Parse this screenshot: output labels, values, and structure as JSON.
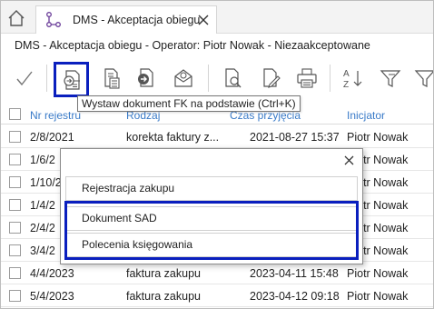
{
  "tab": {
    "title": "DMS - Akceptacja obiegu"
  },
  "subtitle": "DMS - Akceptacja obiegu - Operator: Piotr Nowak - Niezaakceptowane",
  "toolbar": {
    "icons": [
      "checkmark-icon",
      "document-arrow-icon",
      "document-calculator-icon",
      "document-arrow-circle-icon",
      "document-envelope-icon",
      "document-search-icon",
      "document-edit-icon",
      "printer-icon",
      "sort-az-icon",
      "filter-icon",
      "filter-icon"
    ],
    "tooltip": "Wystaw dokument FK na podstawie (Ctrl+K)"
  },
  "grid": {
    "columns": [
      "Nr rejestru",
      "Rodzaj",
      "Czas przyjęcia",
      "Inicjator"
    ],
    "rows": [
      {
        "nr": "2/8/2021",
        "rodzaj": "korekta faktury z...",
        "czas": "2021-08-27 15:37",
        "inicjator": "Piotr Nowak"
      },
      {
        "nr": "1/6/2",
        "rodzaj": "",
        "czas": "",
        "inicjator": "Piotr Nowak"
      },
      {
        "nr": "1/10/2",
        "rodzaj": "",
        "czas": "",
        "inicjator": "Piotr Nowak"
      },
      {
        "nr": "1/4/2",
        "rodzaj": "",
        "czas": "",
        "inicjator": "Piotr Nowak"
      },
      {
        "nr": "2/4/2",
        "rodzaj": "",
        "czas": "",
        "inicjator": "Piotr Nowak"
      },
      {
        "nr": "3/4/2",
        "rodzaj": "",
        "czas": "",
        "inicjator": "Piotr Nowak"
      },
      {
        "nr": "4/4/2023",
        "rodzaj": "faktura zakupu",
        "czas": "2023-04-11 15:48",
        "inicjator": "Piotr Nowak"
      },
      {
        "nr": "5/4/2023",
        "rodzaj": "faktura zakupu",
        "czas": "2023-04-12 09:18",
        "inicjator": "Piotr Nowak"
      }
    ]
  },
  "popup": {
    "items": [
      "Rejestracja zakupu",
      "Dokument SAD",
      "Polecenia księgowania"
    ]
  },
  "colors": {
    "highlight": "#0a1fbe",
    "header_text": "#3a7bc8",
    "accent_icon": "#5a2d82"
  }
}
